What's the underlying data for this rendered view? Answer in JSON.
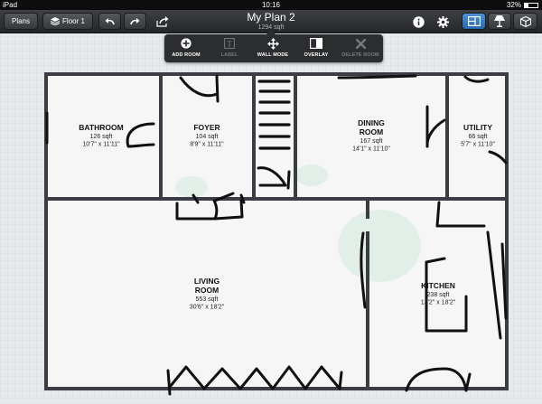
{
  "status": {
    "device": "iPad",
    "time": "10:16",
    "battery": "32%",
    "battery_level": 0.32
  },
  "toolbar": {
    "plans_label": "Plans",
    "floor_label": "Floor 1",
    "title": "My Plan 2",
    "subtitle": "1294 sqft"
  },
  "popover": {
    "items": [
      {
        "label": "ADD ROOM",
        "icon": "plus-icon"
      },
      {
        "label": "LABEL",
        "icon": "text-label-icon"
      },
      {
        "label": "WALL MODE",
        "icon": "move-arrows-icon"
      },
      {
        "label": "OVERLAY",
        "icon": "overlay-icon"
      },
      {
        "label": "DELETE ROOM",
        "icon": "x-delete-icon"
      }
    ]
  },
  "rooms": [
    {
      "name1": "BATHROOM",
      "name2": "",
      "area": "126 sqft",
      "dims": "10'7\" x 11'11\""
    },
    {
      "name1": "FOYER",
      "name2": "",
      "area": "104 sqft",
      "dims": "8'9\" x 11'11\""
    },
    {
      "name1": "DINING",
      "name2": "ROOM",
      "area": "167 sqft",
      "dims": "14'1\" x 11'10\""
    },
    {
      "name1": "UTILITY",
      "name2": "",
      "area": "66 sqft",
      "dims": "5'7\" x 11'10\""
    },
    {
      "name1": "LIVING",
      "name2": "ROOM",
      "area": "553 sqft",
      "dims": "30'6\" x 18'2\""
    },
    {
      "name1": "KITCHEN",
      "name2": "",
      "area": "238 sqft",
      "dims": "13'2\" x 18'2\""
    }
  ],
  "colors": {
    "toolbar": "#2e3033",
    "accent": "#2f7fcc",
    "wall": "#3b3d42",
    "floor": "#f6f6f6",
    "grid": "#d2d4d8"
  }
}
